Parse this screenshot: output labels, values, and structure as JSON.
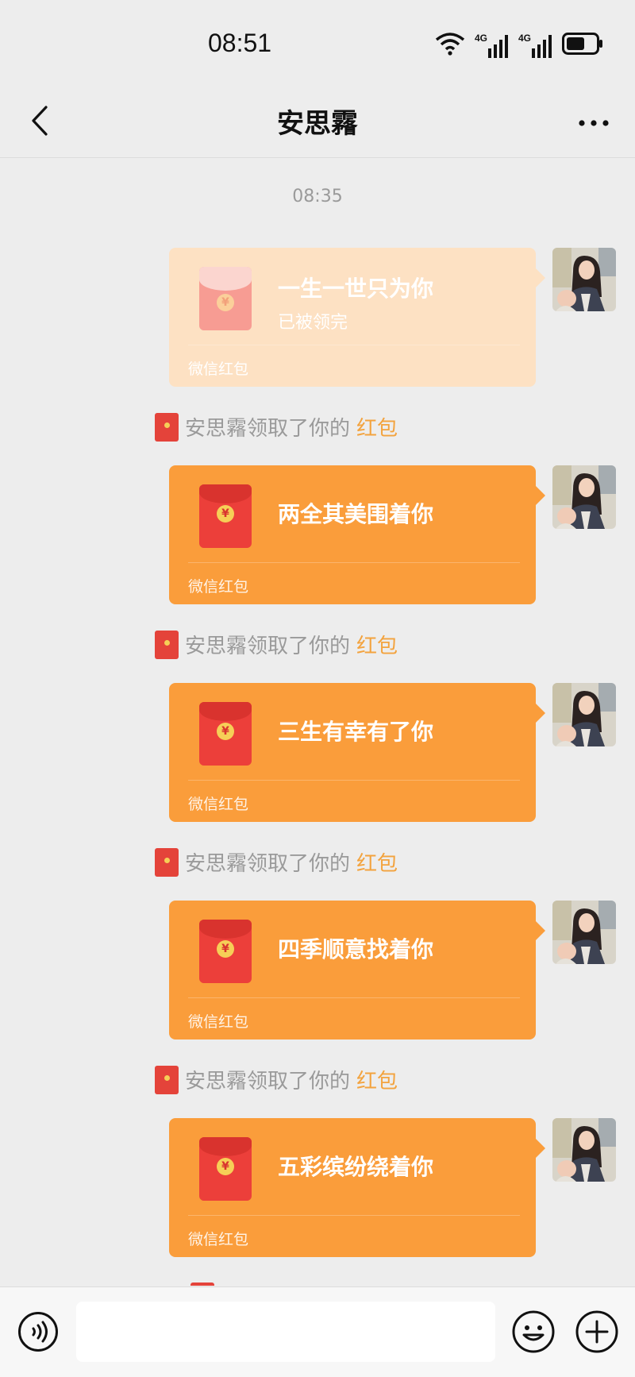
{
  "status_bar": {
    "time": "08:51",
    "net_1": "4G",
    "net_2": "4G"
  },
  "header": {
    "title": "安思霿"
  },
  "chat": {
    "timestamp": "08:35",
    "messages": [
      {
        "title": "一生一世只为你",
        "status": "已被领完",
        "footer": "微信红包",
        "opened": true
      },
      {
        "title": "两全其美围着你",
        "status": "",
        "footer": "微信红包",
        "opened": false
      },
      {
        "title": "三生有幸有了你",
        "status": "",
        "footer": "微信红包",
        "opened": false
      },
      {
        "title": "四季顺意找着你",
        "status": "",
        "footer": "微信红包",
        "opened": false
      },
      {
        "title": "五彩缤纷绕着你",
        "status": "",
        "footer": "微信红包",
        "opened": false
      }
    ],
    "notices": [
      {
        "text": "安思霿领取了你的",
        "link": "红包"
      },
      {
        "text": "安思霿领取了你的",
        "link": "红包"
      },
      {
        "text": "安思霿领取了你的",
        "link": "红包"
      },
      {
        "text": "安思霿领取了你的",
        "link": "红包"
      }
    ]
  },
  "colors": {
    "packet_orange": "#fa9d3b",
    "packet_opened": "#fde1c3",
    "envelope_red": "#ec3f3a",
    "link_orange": "#f3a33e"
  },
  "icons": {
    "back": "chevron-left-icon",
    "more": "more-dots-icon",
    "voice": "voice-icon",
    "emoji": "emoji-icon",
    "plus": "plus-icon"
  }
}
